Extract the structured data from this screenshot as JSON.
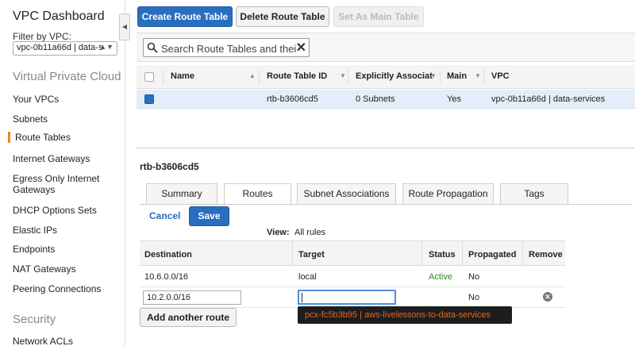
{
  "sidebar": {
    "title": "VPC Dashboard",
    "filter_label": "Filter by VPC:",
    "filter_value": "vpc-0b11a66d | data-s",
    "section_vpc": "Virtual Private Cloud",
    "items": [
      {
        "label": "Your VPCs"
      },
      {
        "label": "Subnets"
      },
      {
        "label": "Route Tables"
      },
      {
        "label": "Internet Gateways"
      },
      {
        "label": "Egress Only Internet Gateways"
      },
      {
        "label": "DHCP Options Sets"
      },
      {
        "label": "Elastic IPs"
      },
      {
        "label": "Endpoints"
      },
      {
        "label": "NAT Gateways"
      },
      {
        "label": "Peering Connections"
      }
    ],
    "section_security": "Security",
    "security_items": [
      {
        "label": "Network ACLs"
      }
    ],
    "active_item": "Route Tables",
    "accent_color": "#e7891e"
  },
  "toolbar": {
    "create_label": "Create Route Table",
    "delete_label": "Delete Route Table",
    "set_main_label": "Set As Main Table"
  },
  "search": {
    "value": "Search Route Tables and thei",
    "clear_icon": "close-icon"
  },
  "grid": {
    "columns": [
      "Name",
      "Route Table ID",
      "Explicitly Associat",
      "Main",
      "VPC"
    ],
    "rows": [
      {
        "name": "",
        "route_table_id": "rtb-b3606cd5",
        "explicit": "0 Subnets",
        "main": "Yes",
        "vpc": "vpc-0b11a66d | data-services",
        "selected": true
      }
    ]
  },
  "detail": {
    "title": "rtb-b3606cd5",
    "tabs": [
      {
        "label": "Summary"
      },
      {
        "label": "Routes"
      },
      {
        "label": "Subnet Associations"
      },
      {
        "label": "Route Propagation"
      },
      {
        "label": "Tags"
      }
    ],
    "active_tab": "Routes",
    "cancel_label": "Cancel",
    "save_label": "Save",
    "view_label": "View:",
    "view_value": "All rules",
    "routes_columns": [
      "Destination",
      "Target",
      "Status",
      "Propagated",
      "Remove"
    ],
    "routes": [
      {
        "destination": "10.6.0.0/16",
        "target": "local",
        "status": "Active",
        "propagated": "No"
      },
      {
        "destination": "10.2.0.0/16",
        "target": "",
        "status": "",
        "propagated": "No"
      }
    ],
    "add_route_label": "Add another route",
    "suggestion": "pcx-fc5b3b95 | aws-livelessons-to-data-services"
  },
  "colors": {
    "primary": "#2a6ec0",
    "active_status": "#2e8b1f",
    "suggestion_text": "#e8651f"
  }
}
